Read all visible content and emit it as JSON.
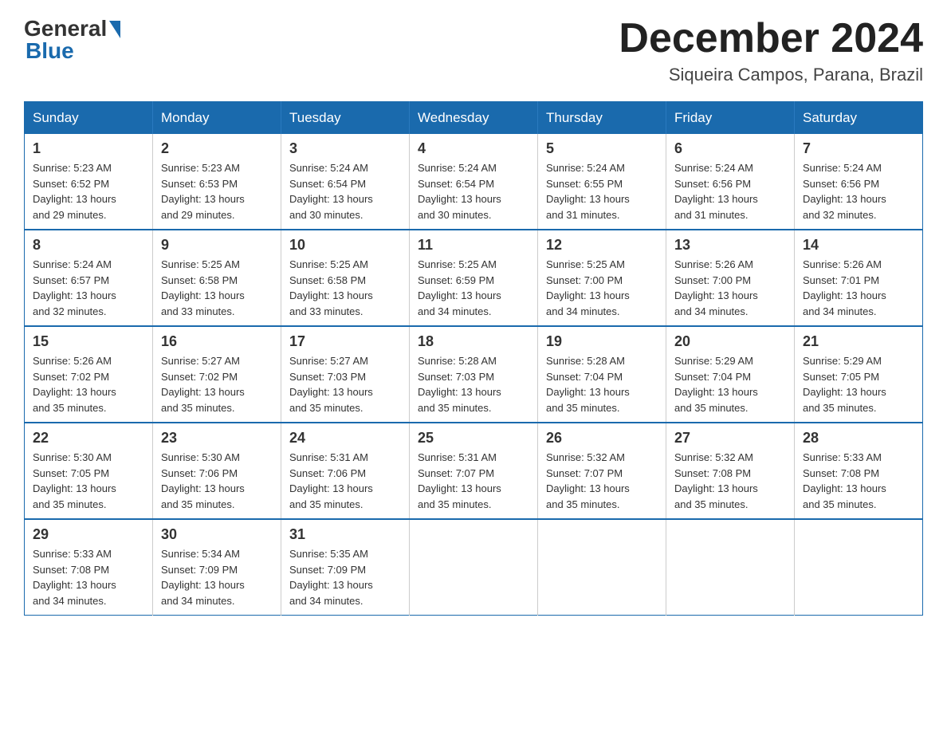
{
  "logo": {
    "general": "General",
    "blue": "Blue"
  },
  "title": "December 2024",
  "location": "Siqueira Campos, Parana, Brazil",
  "headers": [
    "Sunday",
    "Monday",
    "Tuesday",
    "Wednesday",
    "Thursday",
    "Friday",
    "Saturday"
  ],
  "weeks": [
    [
      {
        "day": "1",
        "sunrise": "5:23 AM",
        "sunset": "6:52 PM",
        "daylight": "13 hours and 29 minutes."
      },
      {
        "day": "2",
        "sunrise": "5:23 AM",
        "sunset": "6:53 PM",
        "daylight": "13 hours and 29 minutes."
      },
      {
        "day": "3",
        "sunrise": "5:24 AM",
        "sunset": "6:54 PM",
        "daylight": "13 hours and 30 minutes."
      },
      {
        "day": "4",
        "sunrise": "5:24 AM",
        "sunset": "6:54 PM",
        "daylight": "13 hours and 30 minutes."
      },
      {
        "day": "5",
        "sunrise": "5:24 AM",
        "sunset": "6:55 PM",
        "daylight": "13 hours and 31 minutes."
      },
      {
        "day": "6",
        "sunrise": "5:24 AM",
        "sunset": "6:56 PM",
        "daylight": "13 hours and 31 minutes."
      },
      {
        "day": "7",
        "sunrise": "5:24 AM",
        "sunset": "6:56 PM",
        "daylight": "13 hours and 32 minutes."
      }
    ],
    [
      {
        "day": "8",
        "sunrise": "5:24 AM",
        "sunset": "6:57 PM",
        "daylight": "13 hours and 32 minutes."
      },
      {
        "day": "9",
        "sunrise": "5:25 AM",
        "sunset": "6:58 PM",
        "daylight": "13 hours and 33 minutes."
      },
      {
        "day": "10",
        "sunrise": "5:25 AM",
        "sunset": "6:58 PM",
        "daylight": "13 hours and 33 minutes."
      },
      {
        "day": "11",
        "sunrise": "5:25 AM",
        "sunset": "6:59 PM",
        "daylight": "13 hours and 34 minutes."
      },
      {
        "day": "12",
        "sunrise": "5:25 AM",
        "sunset": "7:00 PM",
        "daylight": "13 hours and 34 minutes."
      },
      {
        "day": "13",
        "sunrise": "5:26 AM",
        "sunset": "7:00 PM",
        "daylight": "13 hours and 34 minutes."
      },
      {
        "day": "14",
        "sunrise": "5:26 AM",
        "sunset": "7:01 PM",
        "daylight": "13 hours and 34 minutes."
      }
    ],
    [
      {
        "day": "15",
        "sunrise": "5:26 AM",
        "sunset": "7:02 PM",
        "daylight": "13 hours and 35 minutes."
      },
      {
        "day": "16",
        "sunrise": "5:27 AM",
        "sunset": "7:02 PM",
        "daylight": "13 hours and 35 minutes."
      },
      {
        "day": "17",
        "sunrise": "5:27 AM",
        "sunset": "7:03 PM",
        "daylight": "13 hours and 35 minutes."
      },
      {
        "day": "18",
        "sunrise": "5:28 AM",
        "sunset": "7:03 PM",
        "daylight": "13 hours and 35 minutes."
      },
      {
        "day": "19",
        "sunrise": "5:28 AM",
        "sunset": "7:04 PM",
        "daylight": "13 hours and 35 minutes."
      },
      {
        "day": "20",
        "sunrise": "5:29 AM",
        "sunset": "7:04 PM",
        "daylight": "13 hours and 35 minutes."
      },
      {
        "day": "21",
        "sunrise": "5:29 AM",
        "sunset": "7:05 PM",
        "daylight": "13 hours and 35 minutes."
      }
    ],
    [
      {
        "day": "22",
        "sunrise": "5:30 AM",
        "sunset": "7:05 PM",
        "daylight": "13 hours and 35 minutes."
      },
      {
        "day": "23",
        "sunrise": "5:30 AM",
        "sunset": "7:06 PM",
        "daylight": "13 hours and 35 minutes."
      },
      {
        "day": "24",
        "sunrise": "5:31 AM",
        "sunset": "7:06 PM",
        "daylight": "13 hours and 35 minutes."
      },
      {
        "day": "25",
        "sunrise": "5:31 AM",
        "sunset": "7:07 PM",
        "daylight": "13 hours and 35 minutes."
      },
      {
        "day": "26",
        "sunrise": "5:32 AM",
        "sunset": "7:07 PM",
        "daylight": "13 hours and 35 minutes."
      },
      {
        "day": "27",
        "sunrise": "5:32 AM",
        "sunset": "7:08 PM",
        "daylight": "13 hours and 35 minutes."
      },
      {
        "day": "28",
        "sunrise": "5:33 AM",
        "sunset": "7:08 PM",
        "daylight": "13 hours and 35 minutes."
      }
    ],
    [
      {
        "day": "29",
        "sunrise": "5:33 AM",
        "sunset": "7:08 PM",
        "daylight": "13 hours and 34 minutes."
      },
      {
        "day": "30",
        "sunrise": "5:34 AM",
        "sunset": "7:09 PM",
        "daylight": "13 hours and 34 minutes."
      },
      {
        "day": "31",
        "sunrise": "5:35 AM",
        "sunset": "7:09 PM",
        "daylight": "13 hours and 34 minutes."
      },
      null,
      null,
      null,
      null
    ]
  ],
  "labels": {
    "sunrise": "Sunrise:",
    "sunset": "Sunset:",
    "daylight": "Daylight:"
  }
}
